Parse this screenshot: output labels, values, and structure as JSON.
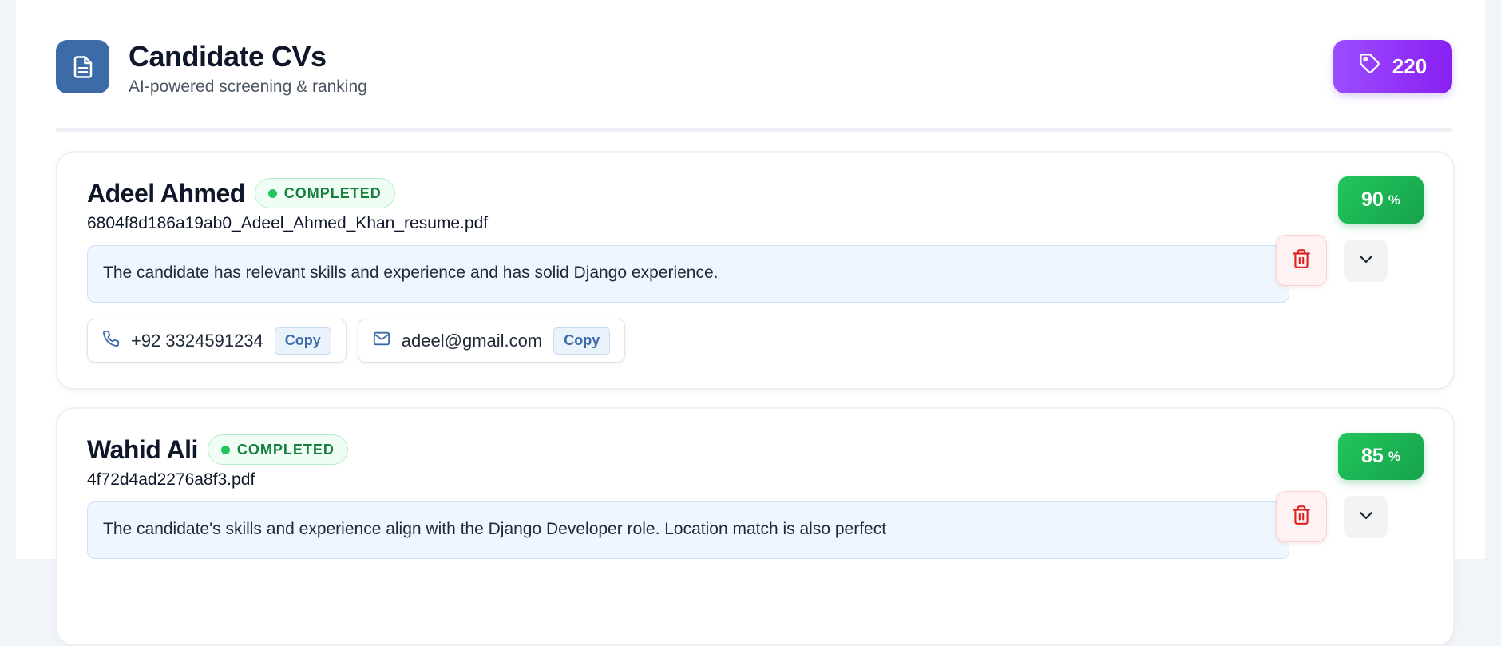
{
  "header": {
    "title": "Candidate CVs",
    "subtitle": "AI-powered screening & ranking",
    "credits": "220",
    "icons": {
      "logo": "document-icon",
      "credits": "tag-icon"
    }
  },
  "candidates": [
    {
      "name": "Adeel Ahmed",
      "status": "COMPLETED",
      "file": "6804f8d186a19ab0_Adeel_Ahmed_Khan_resume.pdf",
      "summary": "The candidate has relevant skills and experience and has solid Django experience.",
      "phone": "+92 3324591234",
      "email": "adeel@gmail.com",
      "copy_label": "Copy",
      "score": "90",
      "score_unit": "%"
    },
    {
      "name": "Wahid Ali",
      "status": "COMPLETED",
      "file": "4f72d4ad2276a8f3.pdf",
      "summary": "The candidate's skills and experience align with the Django Developer role. Location match is also perfect",
      "score": "85",
      "score_unit": "%"
    }
  ],
  "colors": {
    "accent": "#3d6ba8",
    "credits_gradient": [
      "#9b4dff",
      "#8a1ff2"
    ],
    "score": "#16a34a",
    "status": "#15803d",
    "delete": "#dc2626"
  }
}
